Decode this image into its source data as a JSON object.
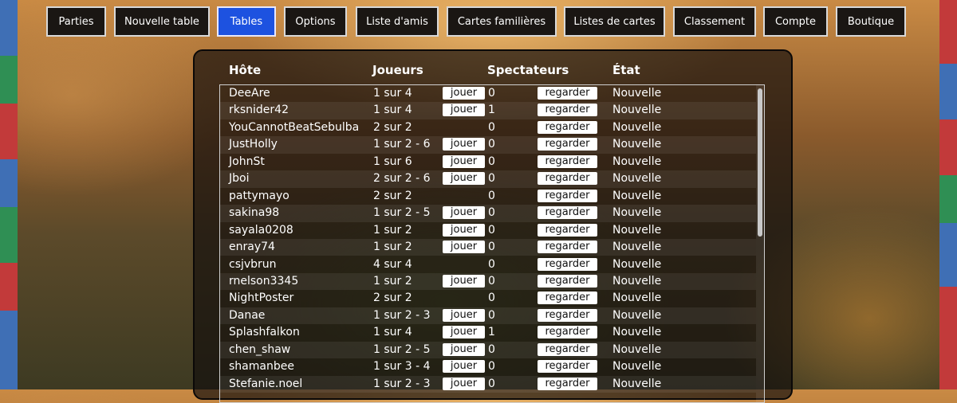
{
  "nav": {
    "items": [
      {
        "label": "Parties"
      },
      {
        "label": "Nouvelle table"
      },
      {
        "label": "Tables"
      },
      {
        "label": "Options"
      },
      {
        "label": "Liste d'amis"
      },
      {
        "label": "Cartes familières"
      },
      {
        "label": "Listes de cartes"
      },
      {
        "label": "Classement"
      },
      {
        "label": "Compte"
      },
      {
        "label": "Boutique"
      }
    ],
    "active": "Tables",
    "active_color": "#1d52e0"
  },
  "table": {
    "headers": {
      "host": "Hôte",
      "players": "Joueurs",
      "spectators": "Spectateurs",
      "state": "État"
    },
    "play_label": "jouer",
    "watch_label": "regarder",
    "rows": [
      {
        "host": "DeeAre",
        "players": "1 sur 4",
        "can_join": true,
        "spectators": "0",
        "state": "Nouvelle"
      },
      {
        "host": "rksnider42",
        "players": "1 sur 4",
        "can_join": true,
        "spectators": "1",
        "state": "Nouvelle"
      },
      {
        "host": "YouCannotBeatSebulba",
        "players": "2 sur 2",
        "can_join": false,
        "spectators": "0",
        "state": "Nouvelle"
      },
      {
        "host": "JustHolly",
        "players": "1 sur 2 - 6",
        "can_join": true,
        "spectators": "0",
        "state": "Nouvelle"
      },
      {
        "host": "JohnSt",
        "players": "1 sur 6",
        "can_join": true,
        "spectators": "0",
        "state": "Nouvelle"
      },
      {
        "host": "Jboi",
        "players": "2 sur 2 - 6",
        "can_join": true,
        "spectators": "0",
        "state": "Nouvelle"
      },
      {
        "host": "pattymayo",
        "players": "2 sur 2",
        "can_join": false,
        "spectators": "0",
        "state": "Nouvelle"
      },
      {
        "host": "sakina98",
        "players": "1 sur 2 - 5",
        "can_join": true,
        "spectators": "0",
        "state": "Nouvelle"
      },
      {
        "host": "sayala0208",
        "players": "1 sur 2",
        "can_join": true,
        "spectators": "0",
        "state": "Nouvelle"
      },
      {
        "host": "enray74",
        "players": "1 sur 2",
        "can_join": true,
        "spectators": "0",
        "state": "Nouvelle"
      },
      {
        "host": "csjvbrun",
        "players": "4 sur 4",
        "can_join": false,
        "spectators": "0",
        "state": "Nouvelle"
      },
      {
        "host": "rnelson3345",
        "players": "1 sur 2",
        "can_join": true,
        "spectators": "0",
        "state": "Nouvelle"
      },
      {
        "host": "NightPoster",
        "players": "2 sur 2",
        "can_join": false,
        "spectators": "0",
        "state": "Nouvelle"
      },
      {
        "host": "Danae",
        "players": "1 sur 2 - 3",
        "can_join": true,
        "spectators": "0",
        "state": "Nouvelle"
      },
      {
        "host": "Splashfalkon",
        "players": "1 sur 4",
        "can_join": true,
        "spectators": "1",
        "state": "Nouvelle"
      },
      {
        "host": "chen_shaw",
        "players": "1 sur 2 - 5",
        "can_join": true,
        "spectators": "0",
        "state": "Nouvelle"
      },
      {
        "host": "shamanbee",
        "players": "1 sur 3 - 4",
        "can_join": true,
        "spectators": "0",
        "state": "Nouvelle"
      },
      {
        "host": "Stefanie.noel",
        "players": "1 sur 2 - 3",
        "can_join": true,
        "spectators": "0",
        "state": "Nouvelle"
      }
    ]
  }
}
